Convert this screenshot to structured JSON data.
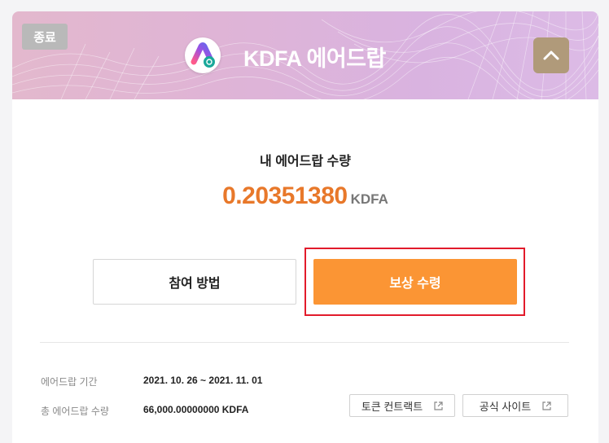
{
  "colors": {
    "accent": "#fb9534",
    "amount": "#e8782a",
    "highlight": "#e21b2b",
    "collapse_button": "#b09a7a",
    "status_badge": "#b9b9b9"
  },
  "header": {
    "status_badge": "종료",
    "title": "KDFA 에어드랍",
    "logo_icon": "kdfa-logo-icon",
    "collapse_icon": "chevron-up-icon"
  },
  "airdrop": {
    "my_amount_label": "내 에어드랍 수량",
    "my_amount": "0.20351380",
    "unit": "KDFA"
  },
  "buttons": {
    "how_to": "참여 방법",
    "claim": "보상 수령"
  },
  "info": {
    "period_label": "에어드랍 기간",
    "period_value": "2021. 10. 26 ~ 2021. 11. 01",
    "total_label": "총 에어드랍 수량",
    "total_value": "66,000.00000000 KDFA"
  },
  "links": {
    "token_contract": "토큰 컨트랙트",
    "official_site": "공식 사이트",
    "icon": "external-link-icon"
  }
}
